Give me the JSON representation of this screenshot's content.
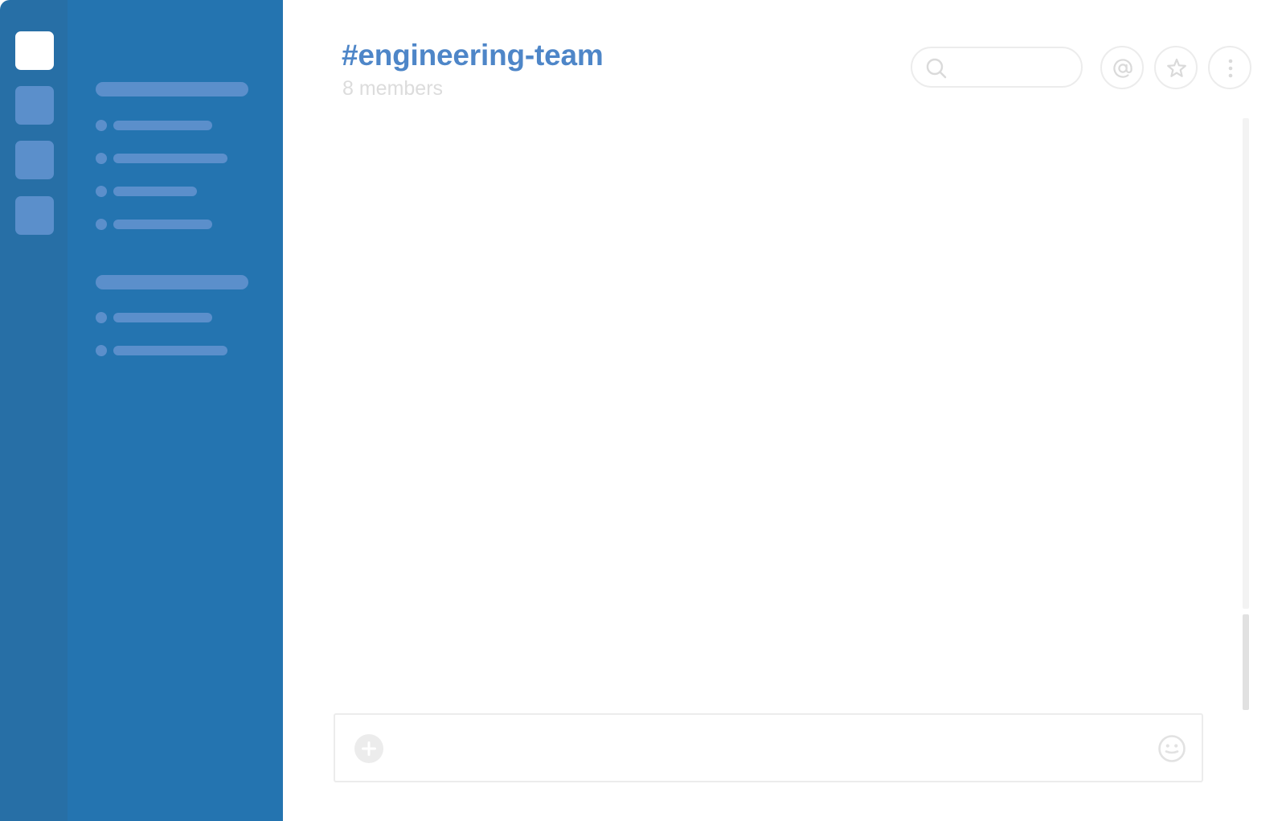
{
  "channel": {
    "name": "#engineering-team",
    "members": "8 members"
  },
  "header": {
    "search_placeholder": "",
    "icons": [
      "search-icon",
      "at-mentions-icon",
      "star-icon",
      "more-vertical-icon"
    ]
  },
  "workspaces": [
    {
      "name": "workspace-1",
      "active": true
    },
    {
      "name": "workspace-2",
      "active": false
    },
    {
      "name": "workspace-3",
      "active": false
    },
    {
      "name": "workspace-4",
      "active": false
    }
  ],
  "composer": {
    "placeholder": "",
    "icons": [
      "add-attachment-icon",
      "emoji-icon"
    ]
  },
  "colors": {
    "rail": "#276fa6",
    "sidebar": "#2474b0",
    "placeholder_block": "#5b8fcb",
    "accent": "#4e86c8",
    "muted_text": "#dcdcdc",
    "border": "#ececec"
  }
}
